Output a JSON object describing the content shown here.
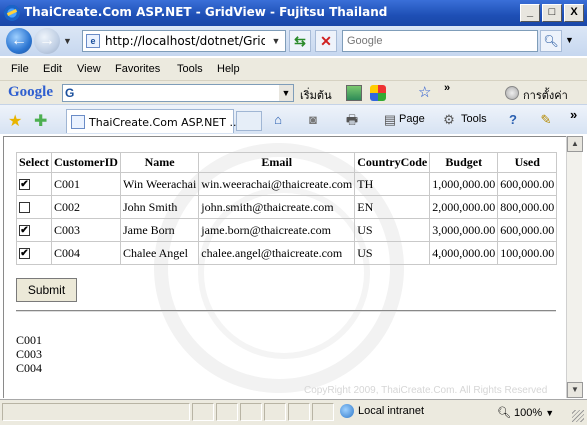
{
  "window": {
    "title": "ThaiCreate.Com ASP.NET - GridView - Fujitsu Thailand",
    "minimize": "_",
    "maximize": "□",
    "close": "X"
  },
  "address": {
    "url": "http://localhost/dotnet/GridViewF",
    "search_placeholder": "Google"
  },
  "menu": [
    "File",
    "Edit",
    "View",
    "Favorites",
    "Tools",
    "Help"
  ],
  "google_toolbar": {
    "logo": "Google",
    "search_letter": "G",
    "start_label": "เริ่มต้น",
    "settings_label": "การตั้งค่า"
  },
  "command_bar": {
    "tab_title": "ThaiCreate.Com ASP.NET ...",
    "page_label": "Page",
    "tools_label": "Tools"
  },
  "grid": {
    "headers": [
      "Select",
      "CustomerID",
      "Name",
      "Email",
      "CountryCode",
      "Budget",
      "Used"
    ],
    "rows": [
      {
        "checked": true,
        "id": "C001",
        "name": "Win Weerachai",
        "email": "win.weerachai@thaicreate.com",
        "country": "TH",
        "budget": "1,000,000.00",
        "used": "600,000.00"
      },
      {
        "checked": false,
        "id": "C002",
        "name": "John Smith",
        "email": "john.smith@thaicreate.com",
        "country": "EN",
        "budget": "2,000,000.00",
        "used": "800,000.00"
      },
      {
        "checked": true,
        "id": "C003",
        "name": "Jame Born",
        "email": "jame.born@thaicreate.com",
        "country": "US",
        "budget": "3,000,000.00",
        "used": "600,000.00"
      },
      {
        "checked": true,
        "id": "C004",
        "name": "Chalee Angel",
        "email": "chalee.angel@thaicreate.com",
        "country": "US",
        "budget": "4,000,000.00",
        "used": "100,000.00"
      }
    ]
  },
  "submit_label": "Submit",
  "output_lines": [
    "C001",
    "C003",
    "C004"
  ],
  "copyright": "CopyRight 2009, ThaiCreate.Com. All Rights Reserved",
  "status": {
    "zone": "Local intranet",
    "zoom": "100%"
  }
}
